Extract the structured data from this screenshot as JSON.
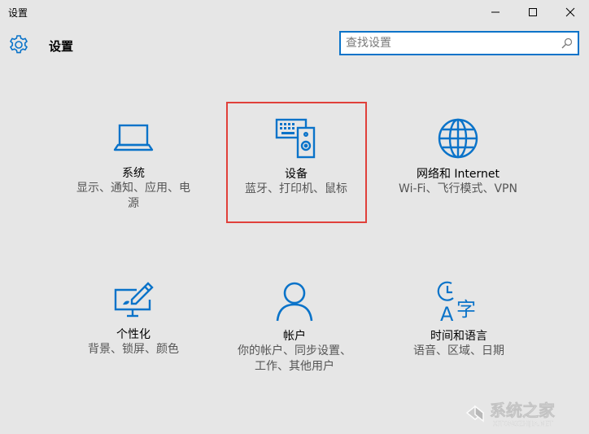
{
  "window": {
    "title": "设置"
  },
  "header": {
    "title": "设置"
  },
  "search": {
    "placeholder": "查找设置"
  },
  "tiles": [
    {
      "id": "system",
      "title": "系统",
      "desc_line1": "显示、通知、应用、电",
      "desc_line2": "源",
      "icon": "laptop-icon"
    },
    {
      "id": "devices",
      "title": "设备",
      "desc_line1": "蓝牙、打印机、鼠标",
      "desc_line2": "",
      "icon": "devices-icon"
    },
    {
      "id": "network",
      "title": "网络和 Internet",
      "desc_line1": "Wi-Fi、飞行模式、VPN",
      "desc_line2": "",
      "icon": "globe-icon"
    },
    {
      "id": "personalization",
      "title": "个性化",
      "desc_line1": "背景、锁屏、颜色",
      "desc_line2": "",
      "icon": "paint-monitor-icon"
    },
    {
      "id": "accounts",
      "title": "帐户",
      "desc_line1": "你的帐户、同步设置、",
      "desc_line2": "工作、其他用户",
      "icon": "person-icon"
    },
    {
      "id": "time-language",
      "title": "时间和语言",
      "desc_line1": "语音、区域、日期",
      "desc_line2": "",
      "icon": "clock-language-icon"
    }
  ],
  "watermark": {
    "text": "系统之家",
    "sub": "XITONGZHIJIA.NET"
  },
  "colors": {
    "accent": "#0a73c9",
    "highlight": "#e0403a",
    "background": "#e6e6e6"
  }
}
